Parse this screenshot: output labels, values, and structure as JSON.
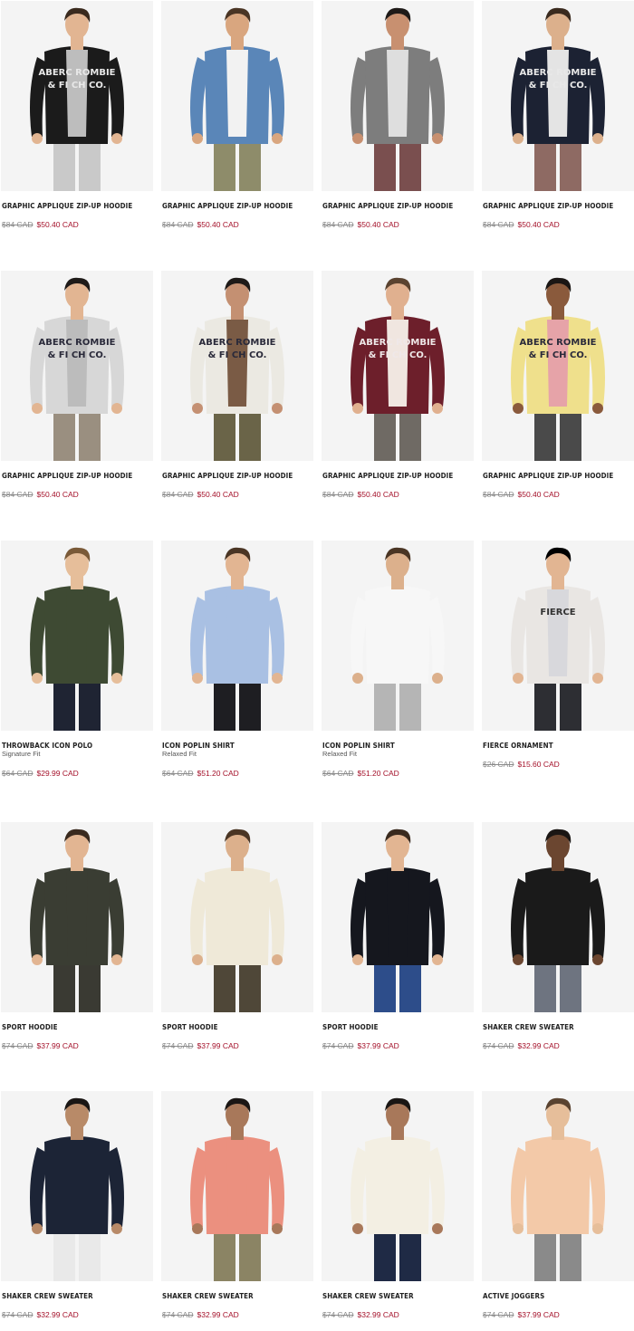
{
  "products": [
    {
      "name": "GRAPHIC APPLIQUE ZIP-UP HOODIE",
      "fit": "",
      "old_price": "$84 CAD",
      "sale_price": "$50.40 CAD",
      "colors": {
        "top": "#1b1b1b",
        "inner": "#bdbdbd",
        "bottom": "#c9c9c9"
      },
      "print": [
        "ABERC ROMBIE",
        "& FI  CH CO."
      ],
      "print_color": "#e8e8e8"
    },
    {
      "name": "GRAPHIC APPLIQUE ZIP-UP HOODIE",
      "fit": "",
      "old_price": "$84 CAD",
      "sale_price": "$50.40 CAD",
      "colors": {
        "top": "#5a86b8",
        "inner": "#f2f2f2",
        "bottom": "#8e8c6a"
      },
      "print": [],
      "print_color": ""
    },
    {
      "name": "GRAPHIC APPLIQUE ZIP-UP HOODIE",
      "fit": "",
      "old_price": "$84 CAD",
      "sale_price": "$50.40 CAD",
      "colors": {
        "top": "#7d7d7d",
        "inner": "#dedede",
        "bottom": "#7a4f4f"
      },
      "print": [],
      "print_color": ""
    },
    {
      "name": "GRAPHIC APPLIQUE ZIP-UP HOODIE",
      "fit": "",
      "old_price": "$84 CAD",
      "sale_price": "$50.40 CAD",
      "colors": {
        "top": "#1c2233",
        "inner": "#e4e4e4",
        "bottom": "#8e6a63"
      },
      "print": [
        "ABERC ROMBIE",
        "& FI  CH CO."
      ],
      "print_color": "#e8e8e8"
    },
    {
      "name": "GRAPHIC APPLIQUE ZIP-UP HOODIE",
      "fit": "",
      "old_price": "$84 CAD",
      "sale_price": "$50.40 CAD",
      "colors": {
        "top": "#d7d7d7",
        "inner": "#bcbcbc",
        "bottom": "#9a8f80"
      },
      "print": [
        "ABERC ROMBIE",
        "& FI  CH CO."
      ],
      "print_color": "#2a2a3a"
    },
    {
      "name": "GRAPHIC APPLIQUE ZIP-UP HOODIE",
      "fit": "",
      "old_price": "$84 CAD",
      "sale_price": "$50.40 CAD",
      "colors": {
        "top": "#ebe9e2",
        "inner": "#7a5b45",
        "bottom": "#6a6448"
      },
      "print": [
        "ABERC ROMBIE",
        "& FI  CH CO."
      ],
      "print_color": "#2a2a3a"
    },
    {
      "name": "GRAPHIC APPLIQUE ZIP-UP HOODIE",
      "fit": "",
      "old_price": "$84 CAD",
      "sale_price": "$50.40 CAD",
      "colors": {
        "top": "#6d1f2b",
        "inner": "#f0e6e0",
        "bottom": "#6f6a64"
      },
      "print": [
        "ABERC ROMBIE",
        "& FI  CH CO."
      ],
      "print_color": "#efe8e8"
    },
    {
      "name": "GRAPHIC APPLIQUE ZIP-UP HOODIE",
      "fit": "",
      "old_price": "$84 CAD",
      "sale_price": "$50.40 CAD",
      "colors": {
        "top": "#efe08c",
        "inner": "#e6a3a8",
        "bottom": "#4a4a4a"
      },
      "print": [
        "ABERC ROMBIE",
        "& FI  CH CO."
      ],
      "print_color": "#2a2a3a"
    },
    {
      "name": "THROWBACK ICON POLO",
      "fit": "Signature Fit",
      "old_price": "$64 CAD",
      "sale_price": "$29.99 CAD",
      "colors": {
        "top": "#3e4a33",
        "inner": "#3e4a33",
        "bottom": "#1f2433"
      },
      "print": [],
      "print_color": ""
    },
    {
      "name": "ICON POPLIN SHIRT",
      "fit": "Relaxed Fit",
      "old_price": "$64 CAD",
      "sale_price": "$51.20 CAD",
      "colors": {
        "top": "#a9c0e3",
        "inner": "#a9c0e3",
        "bottom": "#1e1e22"
      },
      "print": [],
      "print_color": ""
    },
    {
      "name": "ICON POPLIN SHIRT",
      "fit": "Relaxed Fit",
      "old_price": "$64 CAD",
      "sale_price": "$51.20 CAD",
      "colors": {
        "top": "#f7f7f7",
        "inner": "#f7f7f7",
        "bottom": "#b5b5b5"
      },
      "print": [],
      "print_color": ""
    },
    {
      "name": "FIERCE ORNAMENT",
      "fit": "",
      "old_price": "$26 CAD",
      "sale_price": "$15.60 CAD",
      "colors": {
        "top": "#e9e6e3",
        "inner": "#d8d8dc",
        "bottom": "#2d2e33"
      },
      "print": [
        "FIERCE"
      ],
      "print_color": "#333333"
    },
    {
      "name": "SPORT HOODIE",
      "fit": "",
      "old_price": "$74 CAD",
      "sale_price": "$37.99 CAD",
      "colors": {
        "top": "#3a3d33",
        "inner": "#3a3d33",
        "bottom": "#3a3a33"
      },
      "print": [],
      "print_color": ""
    },
    {
      "name": "SPORT HOODIE",
      "fit": "",
      "old_price": "$74 CAD",
      "sale_price": "$37.99 CAD",
      "colors": {
        "top": "#efe9d8",
        "inner": "#efe9d8",
        "bottom": "#4f4738"
      },
      "print": [],
      "print_color": ""
    },
    {
      "name": "SPORT HOODIE",
      "fit": "",
      "old_price": "$74 CAD",
      "sale_price": "$37.99 CAD",
      "colors": {
        "top": "#15171e",
        "inner": "#15171e",
        "bottom": "#2d4d8a"
      },
      "print": [],
      "print_color": ""
    },
    {
      "name": "SHAKER CREW SWEATER",
      "fit": "",
      "old_price": "$74 CAD",
      "sale_price": "$32.99 CAD",
      "colors": {
        "top": "#1a1a1a",
        "inner": "#1a1a1a",
        "bottom": "#6e7480"
      },
      "print": [],
      "print_color": ""
    },
    {
      "name": "SHAKER CREW SWEATER",
      "fit": "",
      "old_price": "$74 CAD",
      "sale_price": "$32.99 CAD",
      "colors": {
        "top": "#1c2436",
        "inner": "#1c2436",
        "bottom": "#e9e9e9"
      },
      "print": [],
      "print_color": ""
    },
    {
      "name": "SHAKER CREW SWEATER",
      "fit": "",
      "old_price": "$74 CAD",
      "sale_price": "$32.99 CAD",
      "colors": {
        "top": "#eb907f",
        "inner": "#eb907f",
        "bottom": "#8b8464"
      },
      "print": [],
      "print_color": ""
    },
    {
      "name": "SHAKER CREW SWEATER",
      "fit": "",
      "old_price": "$74 CAD",
      "sale_price": "$32.99 CAD",
      "colors": {
        "top": "#f3efe3",
        "inner": "#f3efe3",
        "bottom": "#1f2a45"
      },
      "print": [],
      "print_color": ""
    },
    {
      "name": "ACTIVE JOGGERS",
      "fit": "",
      "old_price": "$74 CAD",
      "sale_price": "$37.99 CAD",
      "colors": {
        "top": "#f3c9a8",
        "inner": "#f3c9a8",
        "bottom": "#8a8a8a"
      },
      "print": [],
      "print_color": ""
    }
  ]
}
